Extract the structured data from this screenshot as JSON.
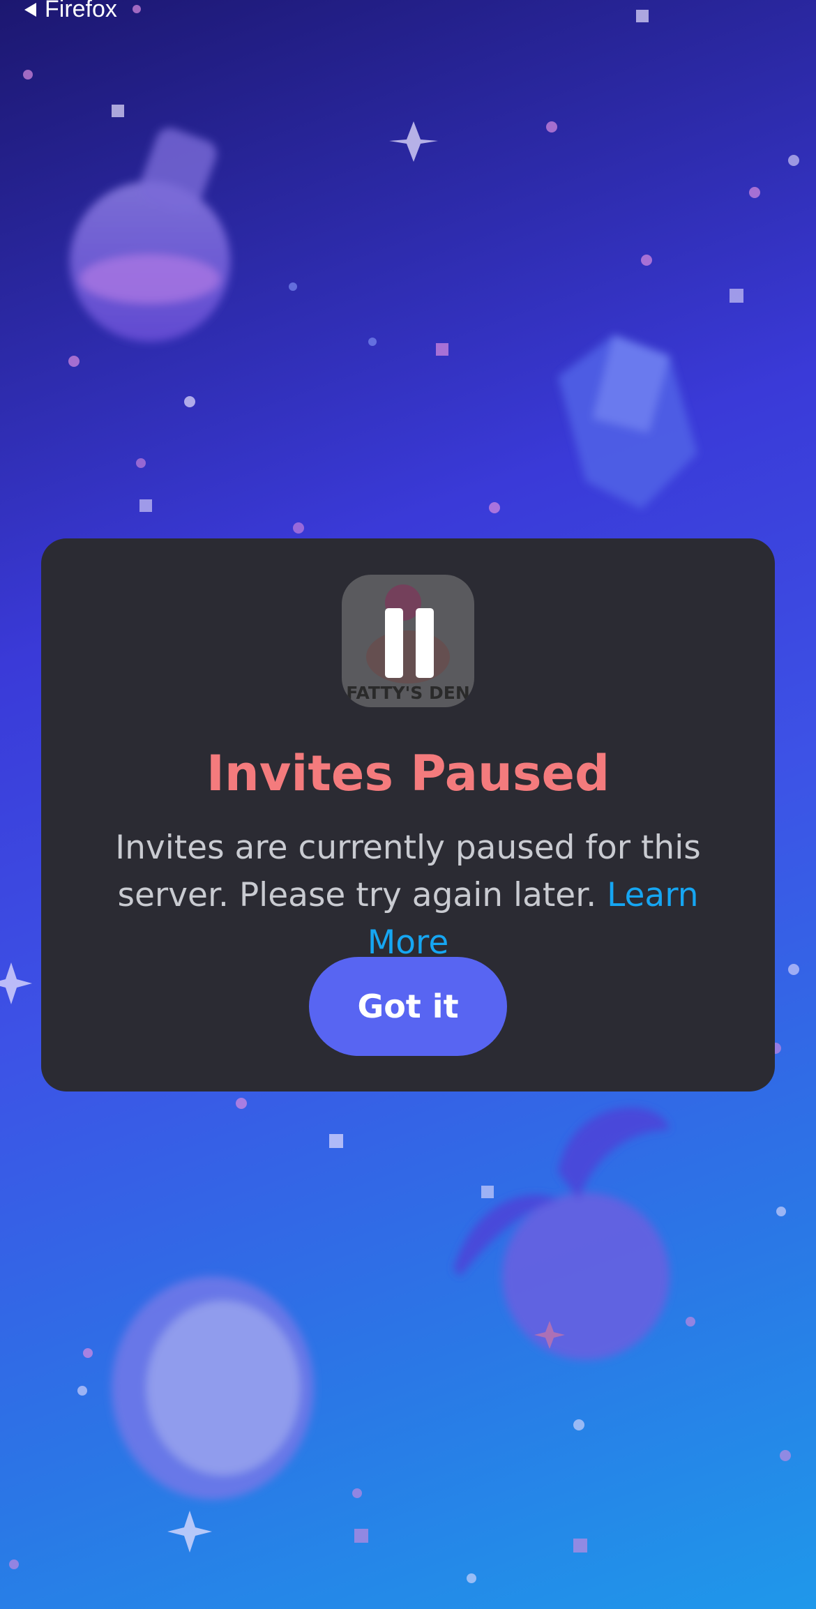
{
  "status_bar": {
    "back_label": "Firefox",
    "back_icon": "back-triangle-icon"
  },
  "modal": {
    "server_icon_text": "FATTY'S DEN",
    "pause_icon": "pause-icon",
    "title": "Invites Paused",
    "description": "Invites are currently paused for this server. Please try again later.",
    "learn_more": "Learn More",
    "button_label": "Got it"
  },
  "colors": {
    "modal_bg": "#2b2b33",
    "title": "#f47b7d",
    "link": "#16a6f2",
    "button": "#5865f2"
  }
}
